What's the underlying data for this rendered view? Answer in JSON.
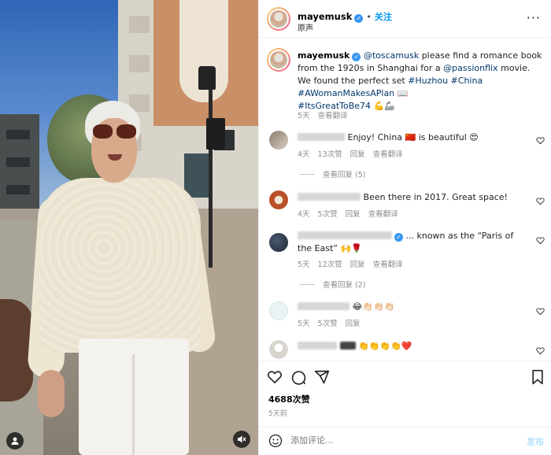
{
  "post": {
    "username": "mayemusk",
    "follow_label": "关注",
    "audio_label": "原声",
    "more_label": "···"
  },
  "caption": {
    "username": "mayemusk",
    "mention": "@toscamusk",
    "text_a": " please find a romance book from the 1920s in Shanghai for a ",
    "mention2": "@passionflix",
    "text_b": " movie. We found the perfect set ",
    "tags_line1": "#Huzhou #China",
    "tags_line2": "#AWomanMakesAPlan 📖",
    "tags_line3": "#ItsGreatToBe74 💪🦾",
    "time": "5天",
    "translate": "查看翻译"
  },
  "comments": [
    {
      "text": "Enjoy! China 🇨🇳 is beautiful 😍",
      "time": "4天",
      "likes": "13次赞",
      "reply": "回复",
      "translate": "查看翻译",
      "view_replies": "查看回复 (5)"
    },
    {
      "text": "Been there in 2017. Great space!",
      "time": "4天",
      "likes": "5次赞",
      "reply": "回复",
      "translate": "查看翻译"
    },
    {
      "text": "... known as the “Paris of the East” 🙌🌹",
      "time": "5天",
      "likes": "12次赞",
      "reply": "回复",
      "translate": "查看翻译",
      "view_replies": "查看回复 (2)"
    },
    {
      "text": "😂👏🏻👏🏻👏🏻",
      "time": "5天",
      "likes": "5次赞",
      "reply": "回复"
    },
    {
      "text": "👏👏👏👏❤️"
    }
  ],
  "footer": {
    "likes": "4688次赞",
    "time": "5天前",
    "comment_placeholder": "添加评论...",
    "post_label": "发布"
  },
  "colors": {
    "accent": "#0095f6",
    "verified": "#3897f0",
    "meta": "#8e8e8e"
  }
}
